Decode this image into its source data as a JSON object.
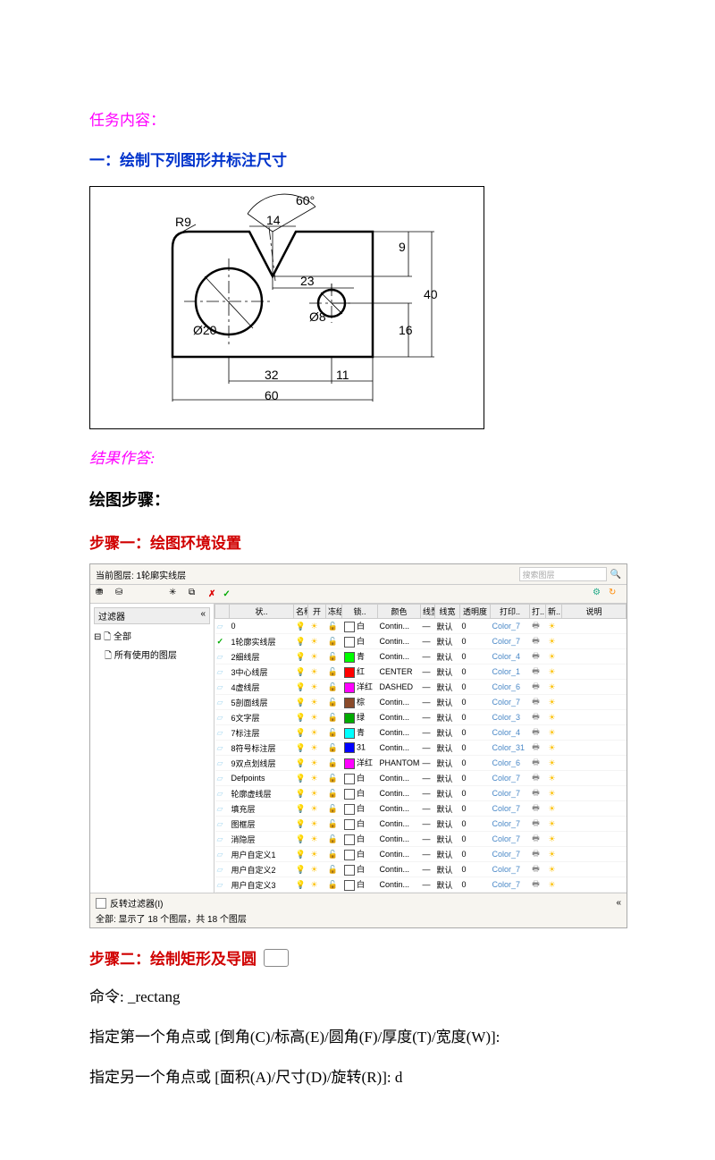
{
  "task": {
    "title": "任务内容："
  },
  "section_one": "一：绘制下列图形并标注尺寸",
  "diagram_labels": {
    "angle": "60°",
    "top_dim": "14",
    "radius": "R9",
    "right_9": "9",
    "right_40": "40",
    "right_16": "16",
    "mid_23": "23",
    "dia20": "Ø20",
    "dia8": "Ø8",
    "bot_32": "32",
    "bot_11": "11",
    "bot_60": "60"
  },
  "result_title": "结果作答:",
  "steps_title": "绘图步骤：",
  "step1": "步骤一：绘图环境设置",
  "step2": "步骤二：绘制矩形及导圆",
  "panel": {
    "top_label": "当前图层: 1轮廓实线层",
    "search_ph": "搜索图层",
    "tree_title": "过滤器",
    "tree_root": "全部",
    "tree_child": "所有使用的图层",
    "invert_chk": "反转过滤器(I)",
    "status_line": "全部: 显示了 18 个图层，共 18 个图层",
    "headers": [
      "状..",
      "名称",
      "开",
      "冻结",
      "锁..",
      "颜色",
      "线型",
      "线宽",
      "透明度",
      "打印..",
      "打..",
      "新..",
      "说明"
    ],
    "rows": [
      {
        "name": "0",
        "color": "#fff",
        "cname": "白",
        "ltype": "Contin...",
        "lw": "—",
        "lwt": "默认",
        "tr": "0",
        "ps": "Color_7"
      },
      {
        "name": "1轮廓实线层",
        "color": "#fff",
        "cname": "白",
        "ltype": "Contin...",
        "lw": "—",
        "lwt": "默认",
        "tr": "0",
        "ps": "Color_7",
        "cur": true
      },
      {
        "name": "2细线层",
        "color": "#0f0",
        "cname": "青",
        "ltype": "Contin...",
        "lw": "—",
        "lwt": "默认",
        "tr": "0",
        "ps": "Color_4"
      },
      {
        "name": "3中心线层",
        "color": "#f00",
        "cname": "红",
        "ltype": "CENTER",
        "lw": "—",
        "lwt": "默认",
        "tr": "0",
        "ps": "Color_1"
      },
      {
        "name": "4虚线层",
        "color": "#f0f",
        "cname": "洋红",
        "ltype": "DASHED",
        "lw": "—",
        "lwt": "默认",
        "tr": "0",
        "ps": "Color_6"
      },
      {
        "name": "5剖面线层",
        "color": "#8a4a2a",
        "cname": "棕",
        "ltype": "Contin...",
        "lw": "—",
        "lwt": "默认",
        "tr": "0",
        "ps": "Color_7"
      },
      {
        "name": "6文字层",
        "color": "#0a0",
        "cname": "绿",
        "ltype": "Contin...",
        "lw": "—",
        "lwt": "默认",
        "tr": "0",
        "ps": "Color_3"
      },
      {
        "name": "7标注层",
        "color": "#0ff",
        "cname": "青",
        "ltype": "Contin...",
        "lw": "—",
        "lwt": "默认",
        "tr": "0",
        "ps": "Color_4"
      },
      {
        "name": "8符号标注层",
        "color": "#00f",
        "cname": "31",
        "ltype": "Contin...",
        "lw": "—",
        "lwt": "默认",
        "tr": "0",
        "ps": "Color_31"
      },
      {
        "name": "9双点划线层",
        "color": "#f0f",
        "cname": "洋红",
        "ltype": "PHANTOM",
        "lw": "—",
        "lwt": "默认",
        "tr": "0",
        "ps": "Color_6"
      },
      {
        "name": "Defpoints",
        "color": "#fff",
        "cname": "白",
        "ltype": "Contin...",
        "lw": "—",
        "lwt": "默认",
        "tr": "0",
        "ps": "Color_7"
      },
      {
        "name": "轮廓虚线层",
        "color": "#fff",
        "cname": "白",
        "ltype": "Contin...",
        "lw": "—",
        "lwt": "默认",
        "tr": "0",
        "ps": "Color_7"
      },
      {
        "name": "填充层",
        "color": "#fff",
        "cname": "白",
        "ltype": "Contin...",
        "lw": "—",
        "lwt": "默认",
        "tr": "0",
        "ps": "Color_7"
      },
      {
        "name": "图框层",
        "color": "#fff",
        "cname": "白",
        "ltype": "Contin...",
        "lw": "—",
        "lwt": "默认",
        "tr": "0",
        "ps": "Color_7"
      },
      {
        "name": "消隐层",
        "color": "#fff",
        "cname": "白",
        "ltype": "Contin...",
        "lw": "—",
        "lwt": "默认",
        "tr": "0",
        "ps": "Color_7"
      },
      {
        "name": "用户自定义1",
        "color": "#fff",
        "cname": "白",
        "ltype": "Contin...",
        "lw": "—",
        "lwt": "默认",
        "tr": "0",
        "ps": "Color_7"
      },
      {
        "name": "用户自定义2",
        "color": "#fff",
        "cname": "白",
        "ltype": "Contin...",
        "lw": "—",
        "lwt": "默认",
        "tr": "0",
        "ps": "Color_7"
      },
      {
        "name": "用户自定义3",
        "color": "#fff",
        "cname": "白",
        "ltype": "Contin...",
        "lw": "—",
        "lwt": "默认",
        "tr": "0",
        "ps": "Color_7"
      }
    ]
  },
  "cmd1": "命令: _rectang",
  "cmd2": "指定第一个角点或 [倒角(C)/标高(E)/圆角(F)/厚度(T)/宽度(W)]:",
  "cmd3": "指定另一个角点或 [面积(A)/尺寸(D)/旋转(R)]: d"
}
